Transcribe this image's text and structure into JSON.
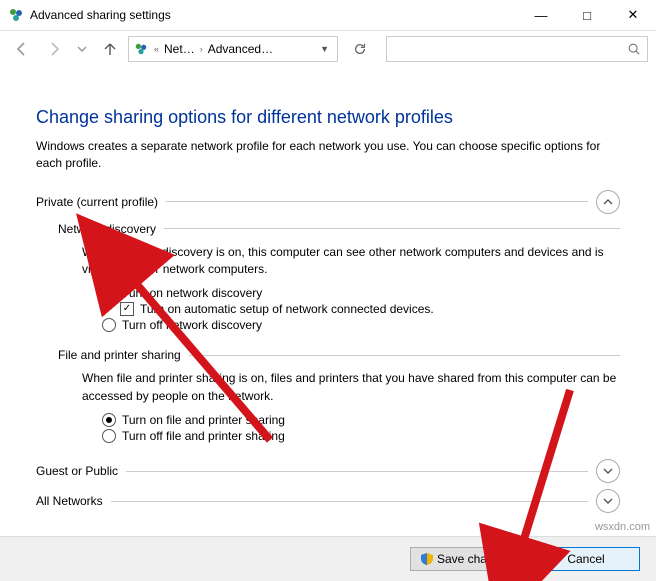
{
  "window": {
    "title": "Advanced sharing settings"
  },
  "nav": {
    "breadcrumb": {
      "item1": "Net…",
      "item2": "Advanced…"
    },
    "search_placeholder": ""
  },
  "main": {
    "heading": "Change sharing options for different network profiles",
    "description": "Windows creates a separate network profile for each network you use. You can choose specific options for each profile."
  },
  "sections": {
    "private_label": "Private (current profile)",
    "guest_label": "Guest or Public",
    "allnet_label": "All Networks"
  },
  "network_discovery": {
    "heading": "Network discovery",
    "desc": "When network discovery is on, this computer can see other network computers and devices and is visible to other network computers.",
    "opt_on": "Turn on network discovery",
    "opt_auto": "Turn on automatic setup of network connected devices.",
    "opt_off": "Turn off network discovery"
  },
  "file_printer": {
    "heading": "File and printer sharing",
    "desc": "When file and printer sharing is on, files and printers that you have shared from this computer can be accessed by people on the network.",
    "opt_on": "Turn on file and printer sharing",
    "opt_off": "Turn off file and printer sharing"
  },
  "footer": {
    "save": "Save changes",
    "cancel": "Cancel"
  },
  "watermark": "wsxdn.com"
}
